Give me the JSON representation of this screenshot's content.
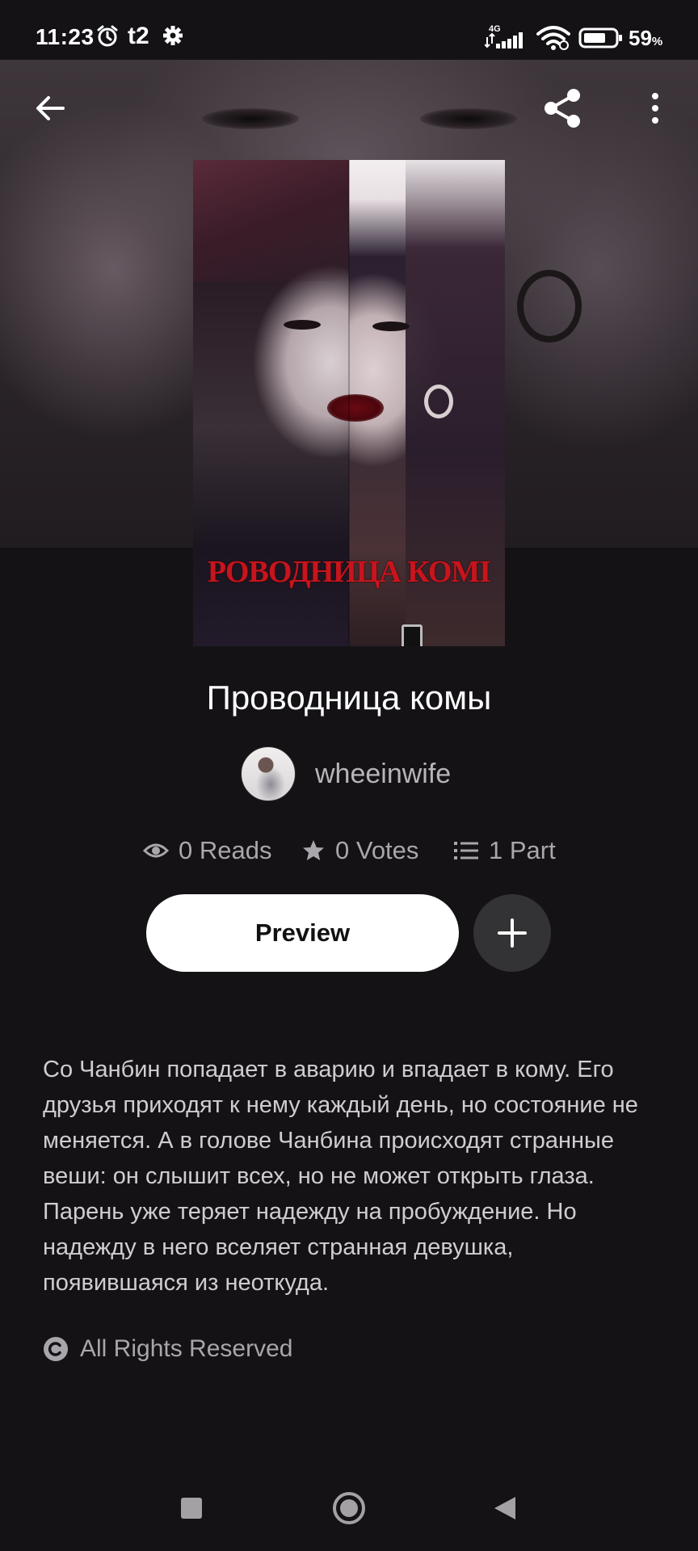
{
  "status_bar": {
    "time": "11:23",
    "carrier": "t2",
    "network": "4G",
    "battery_percent": "59",
    "battery_unit": "%",
    "icons": [
      "alarm-icon",
      "settings-icon",
      "signal-icon",
      "wifi-icon",
      "battery-icon"
    ]
  },
  "header": {
    "back_icon": "arrow-left-icon",
    "share_icon": "share-icon",
    "more_icon": "more-vertical-icon"
  },
  "cover": {
    "cover_text": "РОВОДНИЦА КОМІ"
  },
  "story": {
    "title": "Проводница комы",
    "author": "wheeinwife",
    "stats": {
      "reads": "0 Reads",
      "votes": "0 Votes",
      "parts": "1 Part"
    },
    "preview_label": "Preview",
    "description": "Со Чанбин попадает в аварию и впадает в кому. Его друзья приходят к нему каждый день, но состояние не меняется. А в голове Чанбина происходят странные веши: он слышит всех, но не может открыть глаза. Парень уже теряет надежду на пробуждение. Но надежду в него вселяет странная девушка, появившаяся из неоткуда.",
    "license": "All Rights Reserved"
  },
  "colors": {
    "background": "#141215",
    "text_primary": "#ffffff",
    "text_secondary": "#a9a7ab",
    "button_primary": "#ffffff",
    "button_secondary": "#333234",
    "cover_title_red": "#c8141c"
  },
  "nav_bar": {
    "icons": [
      "recents-square-icon",
      "home-circle-icon",
      "back-triangle-icon"
    ]
  }
}
